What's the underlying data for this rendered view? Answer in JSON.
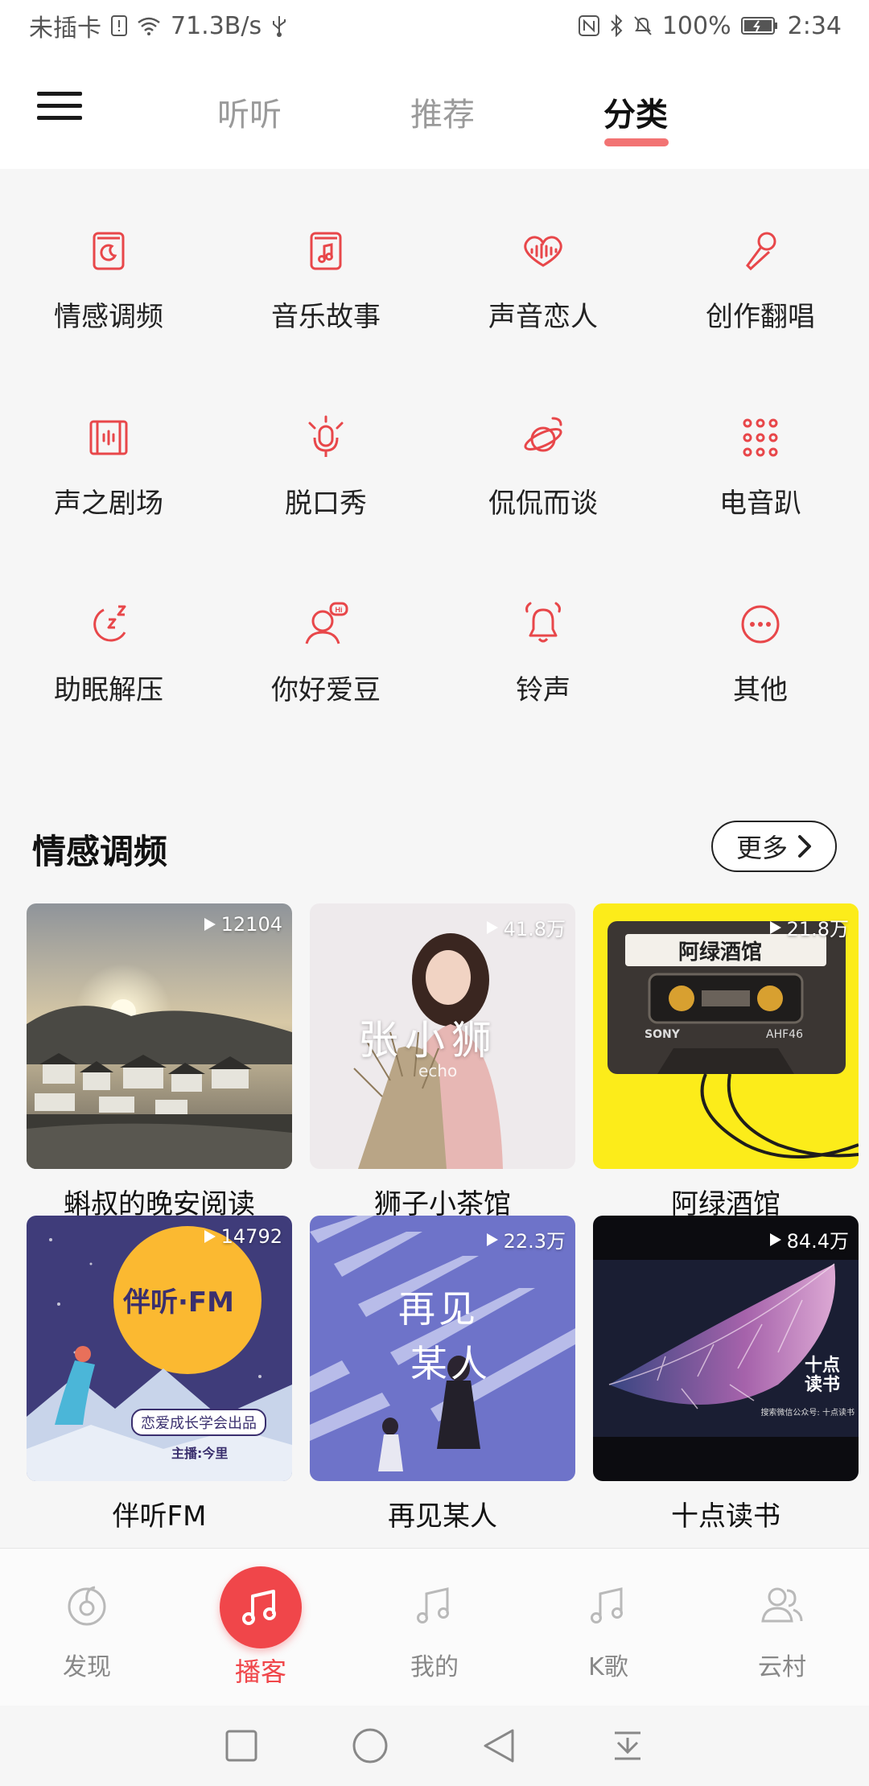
{
  "status_bar": {
    "carrier": "未插卡",
    "speed": "71.3B/s",
    "battery": "100%",
    "time": "2:34"
  },
  "header": {
    "tabs": [
      {
        "label": "听听"
      },
      {
        "label": "推荐"
      },
      {
        "label": "分类"
      }
    ],
    "active_tab": "分类"
  },
  "categories": [
    {
      "label": "情感调频",
      "icon": "moon-book-icon"
    },
    {
      "label": "音乐故事",
      "icon": "music-book-icon"
    },
    {
      "label": "声音恋人",
      "icon": "heart-wave-icon"
    },
    {
      "label": "创作翻唱",
      "icon": "microphone-icon"
    },
    {
      "label": "声之剧场",
      "icon": "film-wave-icon"
    },
    {
      "label": "脱口秀",
      "icon": "talk-mic-icon"
    },
    {
      "label": "侃侃而谈",
      "icon": "chat-planet-icon"
    },
    {
      "label": "电音趴",
      "icon": "dots-grid-icon"
    },
    {
      "label": "助眠解压",
      "icon": "sleep-icon"
    },
    {
      "label": "你好爱豆",
      "icon": "idol-hi-icon"
    },
    {
      "label": "铃声",
      "icon": "bell-icon"
    },
    {
      "label": "其他",
      "icon": "more-dots-icon"
    }
  ],
  "section": {
    "title": "情感调频",
    "more_label": "更多",
    "cards": [
      {
        "title": "蝌叔的晚安阅读",
        "plays": "12104"
      },
      {
        "title": "狮子小茶馆",
        "plays": "41.8万"
      },
      {
        "title": "阿绿酒馆",
        "plays": "21.8万"
      },
      {
        "title": "伴听FM",
        "plays": "14792"
      },
      {
        "title": "再见某人",
        "plays": "22.3万"
      },
      {
        "title": "十点读书",
        "plays": "84.4万"
      }
    ],
    "cover_texts": {
      "card2": "张小狮",
      "card2_sub": "echo",
      "card3_label": "阿绿酒馆",
      "card3_brand": "SONY",
      "card3_model": "AHF46",
      "card4_logo": "伴听·FM",
      "card4_sub": "恋爱成长学会出品",
      "card4_host": "主播:今里",
      "card5_title_1": "再见",
      "card5_title_2": "某人",
      "card6_logo": "十点读书",
      "card6_sub": "搜索微信公众号: 十点读书"
    }
  },
  "bottom_nav": [
    {
      "label": "发现",
      "icon": "discover-icon"
    },
    {
      "label": "播客",
      "icon": "podcast-music-icon"
    },
    {
      "label": "我的",
      "icon": "music-note-icon"
    },
    {
      "label": "K歌",
      "icon": "karaoke-note-icon"
    },
    {
      "label": "云村",
      "icon": "friends-icon"
    }
  ],
  "colors": {
    "accent": "#f0464a",
    "icon_red": "#e8474a",
    "background": "#f6f6f6"
  }
}
